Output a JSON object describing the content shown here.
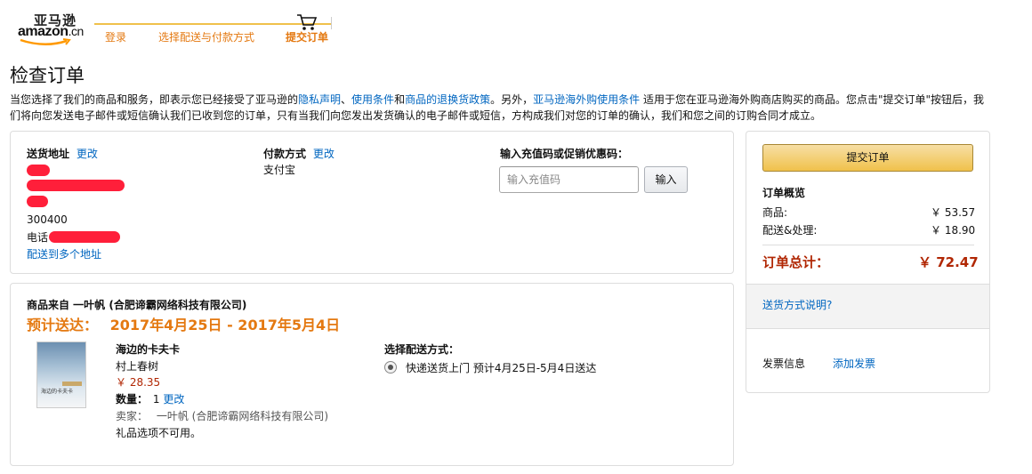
{
  "header": {
    "logo_cn": "亚马逊",
    "logo_en": "amazon",
    "logo_suffix": ".cn",
    "steps": [
      "登录",
      "选择配送与付款方式",
      "提交订单"
    ]
  },
  "page_title": "检查订单",
  "notice": {
    "p1": "当您选择了我们的商品和服务，即表示您已经接受了亚马逊的",
    "privacy": "隐私声明",
    "sep1": "、",
    "terms": "使用条件",
    "and": "和",
    "returns": "商品的退换货政策",
    "p2": "。另外，",
    "overseas": "亚马逊海外购使用条件",
    "p3": " 适用于您在亚马逊海外购商店购买的商品。您点击\"提交订单\"按钮后，我们将向您发送电子邮件或短信确认我们已收到您的订单，只有当我们向您发出发货确认的电子邮件或短信，方构成我们对您的订单的确认，我们和您之间的订购合同才成立。"
  },
  "shipping": {
    "label": "送货地址",
    "change": "更改",
    "zip": "300400",
    "phone_prefix": "电话",
    "multi": "配送到多个地址"
  },
  "payment": {
    "label": "付款方式",
    "change": "更改",
    "method": "支付宝"
  },
  "promo": {
    "label": "输入充值码或促销优惠码：",
    "placeholder": "输入充值码",
    "apply": "输入"
  },
  "summary": {
    "submit": "提交订单",
    "title": "订单概览",
    "items_label": "商品:",
    "items_value": "￥ 53.57",
    "shipping_label": "配送&处理:",
    "shipping_value": "￥ 18.90",
    "total_label": "订单总计：",
    "total_value": "￥ 72.47",
    "shipping_info": "送货方式说明?",
    "invoice_label": "发票信息",
    "invoice_add": "添加发票"
  },
  "order": {
    "seller_line": "商品来自 一叶帆 (合肥谛霸网络科技有限公司)",
    "eta_label": "预计送达：",
    "eta_range": "2017年4月25日 - 2017年5月4日",
    "book_title": "海边的卡夫卡",
    "author": "村上春树",
    "price": "￥ 28.35",
    "qty_label": "数量：",
    "qty": "1",
    "qty_change": "更改",
    "seller_label": "卖家：",
    "seller": "一叶帆 (合肥谛霸网络科技有限公司)",
    "gift": "礼品选项不可用。",
    "ship_method_label": "选择配送方式：",
    "ship_option": "快递送货上门 预计4月25日-5月4日送达",
    "cover_text": "海边的卡夫卡"
  }
}
